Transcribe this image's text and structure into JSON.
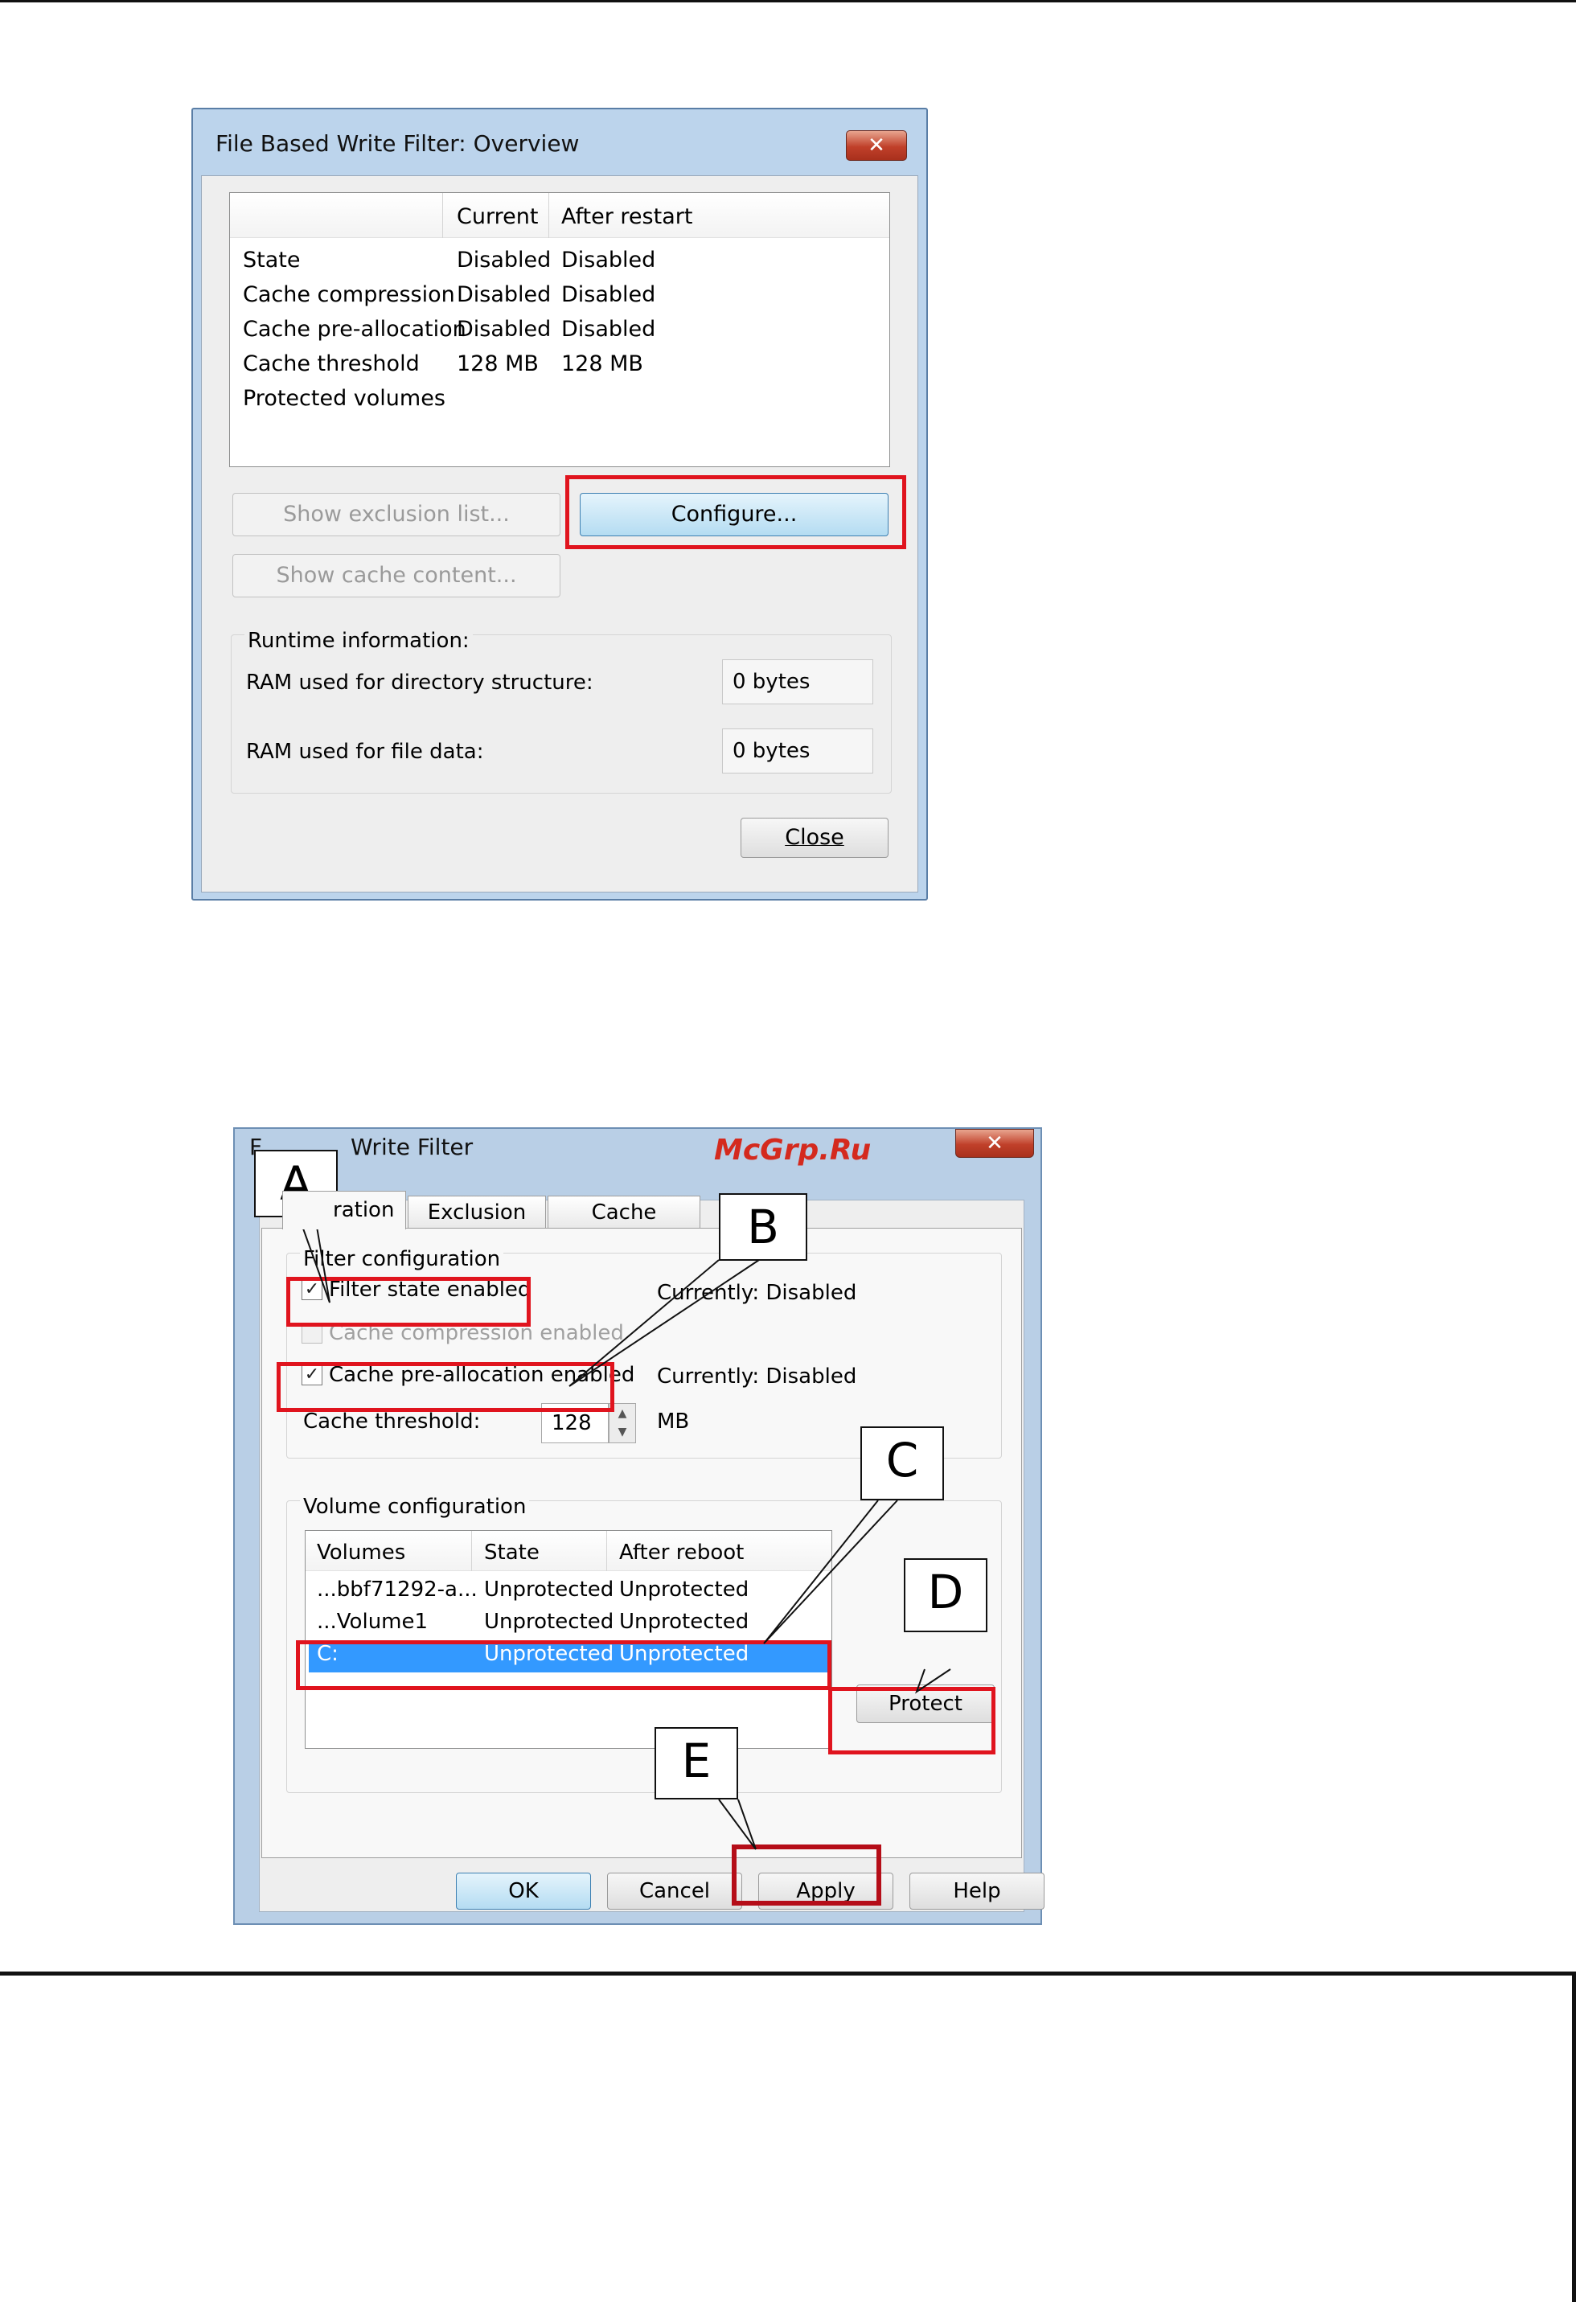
{
  "overview": {
    "title": "File Based Write Filter: Overview",
    "close_glyph": "✕",
    "columns": [
      "",
      "Current",
      "After restart"
    ],
    "rows": [
      {
        "label": "State",
        "current": "Disabled",
        "after": "Disabled"
      },
      {
        "label": "Cache compression",
        "current": "Disabled",
        "after": "Disabled"
      },
      {
        "label": "Cache pre-allocation",
        "current": "Disabled",
        "after": "Disabled"
      },
      {
        "label": "Cache threshold",
        "current": "128 MB",
        "after": "128 MB"
      },
      {
        "label": "Protected volumes",
        "current": "",
        "after": ""
      }
    ],
    "show_exclusion_label": "Show exclusion list...",
    "configure_label": "Configure...",
    "show_cache_label": "Show cache content...",
    "runtime_title": "Runtime information:",
    "ram_dir_label": "RAM used for directory structure:",
    "ram_dir_value": "0 bytes",
    "ram_file_label": "RAM used for file data:",
    "ram_file_value": "0 bytes",
    "close_label": "Close"
  },
  "config": {
    "title": "Write Filter",
    "title_prefix": "F",
    "close_glyph": "✕",
    "tabs": [
      "ration",
      "Exclusion List",
      "Cache Content"
    ],
    "filter_group_title": "Filter configuration",
    "filter_state": {
      "label": "Filter state enabled",
      "checked": true,
      "status": "Currently: Disabled"
    },
    "cache_compression": {
      "label": "Cache compression enabled",
      "checked": false,
      "disabled": true
    },
    "cache_prealloc": {
      "label": "Cache pre-allocation enabled",
      "checked": true,
      "status": "Currently: Disabled"
    },
    "threshold_label": "Cache threshold:",
    "threshold_value": "128",
    "threshold_unit": "MB",
    "volume_group_title": "Volume configuration",
    "volume_columns": [
      "Volumes",
      "State",
      "After reboot"
    ],
    "volumes": [
      {
        "name": "...bbf71292-a...",
        "state": "Unprotected",
        "after": "Unprotected",
        "selected": false
      },
      {
        "name": "...Volume1",
        "state": "Unprotected",
        "after": "Unprotected",
        "selected": false
      },
      {
        "name": "C:",
        "state": "Unprotected",
        "after": "Unprotected",
        "selected": true
      }
    ],
    "protect_label": "Protect",
    "ok_label": "OK",
    "cancel_label": "Cancel",
    "apply_label": "Apply",
    "help_label": "Help"
  },
  "callouts": [
    "A",
    "B",
    "C",
    "D",
    "E"
  ],
  "watermark": "McGrp.Ru",
  "colors": {
    "highlight": "#e0141e",
    "selection": "#3399ff"
  }
}
